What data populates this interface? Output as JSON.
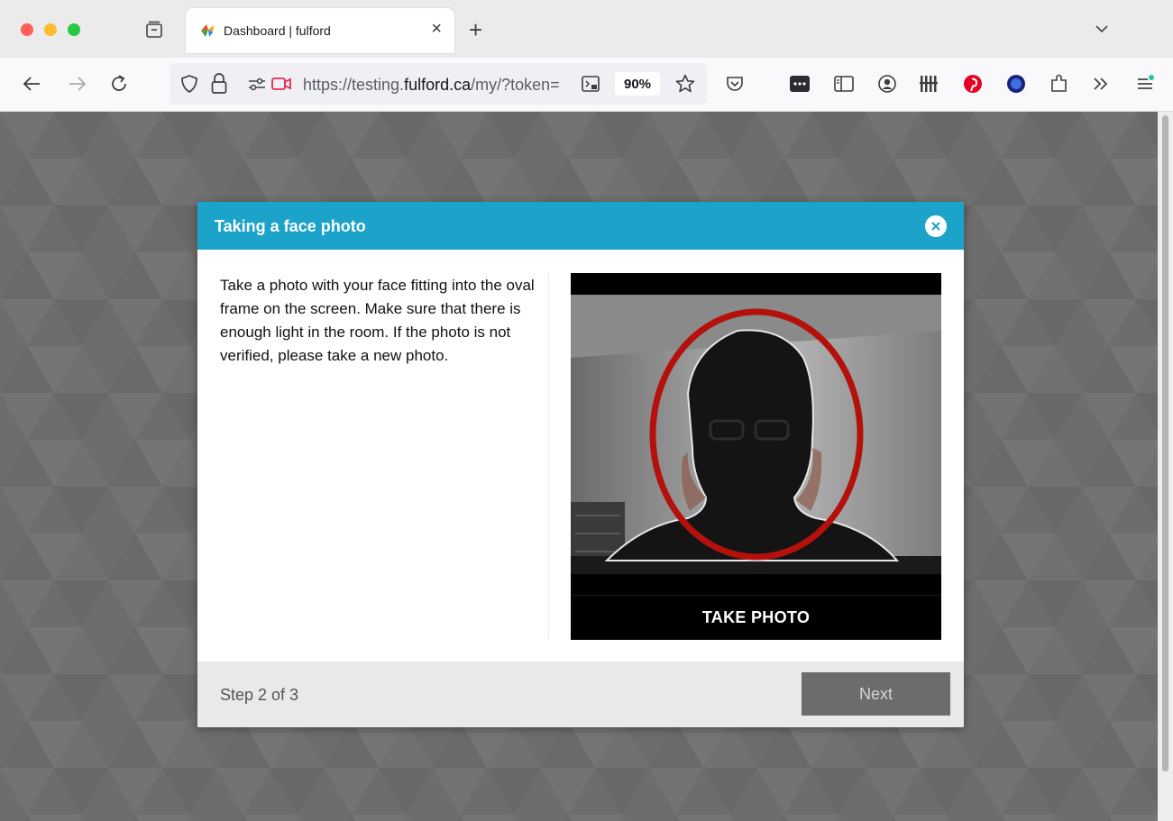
{
  "browser": {
    "tab": {
      "title": "Dashboard | fulford"
    },
    "url": {
      "prefix": "https://testing.",
      "host": "fulford.ca",
      "rest": "/my/?token="
    },
    "zoom": "90%"
  },
  "modal": {
    "title": "Taking a face photo",
    "instructions": "Take a photo with your face fitting into the oval frame on the screen. Make sure that there is enough light in the room. If the photo is not verified, please take a new photo.",
    "take_photo_label": "TAKE PHOTO",
    "step": "Step 2 of 3",
    "next_label": "Next"
  },
  "icons": {
    "back": "back-arrow-icon",
    "forward": "forward-arrow-icon",
    "reload": "reload-icon",
    "shield": "tracking-shield-icon",
    "lock": "lock-icon",
    "permissions": "permissions-icon",
    "camera": "camera-in-use-icon",
    "reader": "reader-view-icon",
    "bookmark": "bookmark-star-icon",
    "pocket": "pocket-icon",
    "extensions": [
      "dots-extension-icon",
      "sidebar-icon",
      "account-icon",
      "bars-extension-icon",
      "pinterest-icon",
      "blue-circle-extension-icon",
      "puzzle-icon",
      "overflow-chevron-icon",
      "menu-icon"
    ]
  },
  "colors": {
    "header": "#1ba3c9",
    "oval": "#b5110c",
    "next_button": "#6c6c6c",
    "backdrop": "#6e6e6e"
  }
}
